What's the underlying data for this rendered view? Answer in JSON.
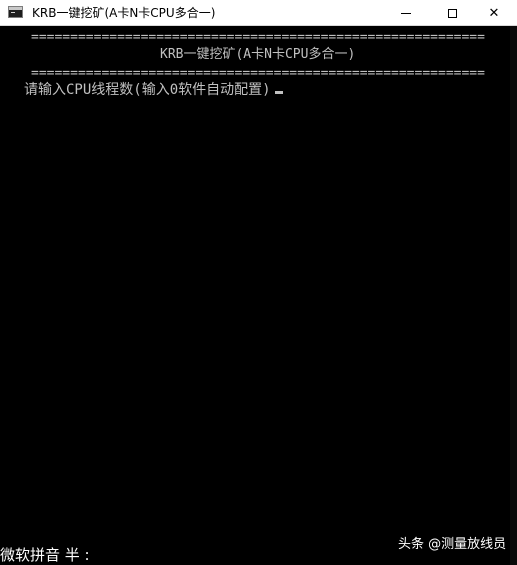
{
  "window": {
    "title": "KRB一键挖矿(A卡N卡CPU多合一)",
    "icon": "console-app-icon",
    "controls": {
      "minimize_icon": "minimize-icon",
      "maximize_icon": "maximize-icon",
      "close_icon": "close-icon",
      "close_glyph": "✕"
    }
  },
  "console": {
    "separator_top": "==========================================================",
    "banner": "KRB一键挖矿(A卡N卡CPU多合一)",
    "separator_bottom": "==========================================================",
    "prompt": "请输入CPU线程数(输入0软件自动配置)",
    "text_color": "#c0c0c0",
    "background_color": "#000000"
  },
  "ime": {
    "status": "微软拼音 半 :"
  },
  "watermark": {
    "text": "头条 @测量放线员"
  }
}
